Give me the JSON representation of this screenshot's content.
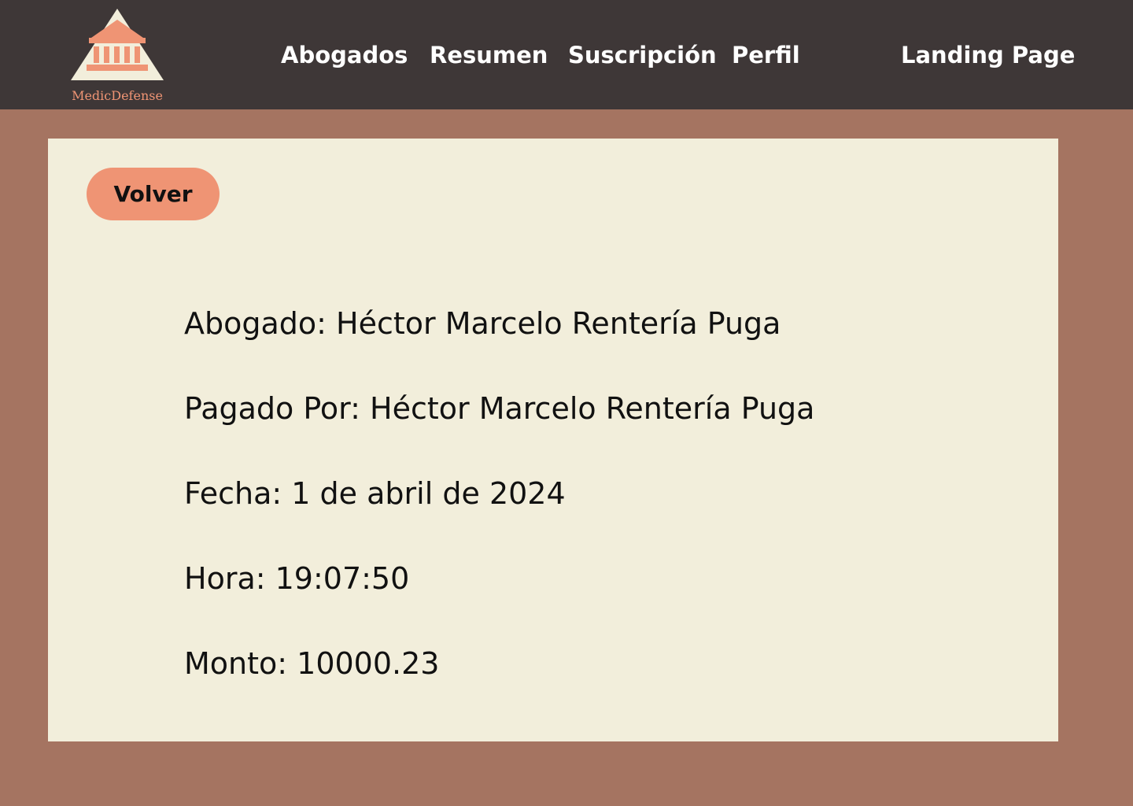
{
  "brand": {
    "name": "MedicDefense",
    "logo_icon": "bank-building-icon",
    "colors": {
      "accent": "#ef9474",
      "header_bg": "#3e3737",
      "page_bg": "#a57461",
      "card_bg": "#f2eedb"
    }
  },
  "nav": {
    "items": [
      {
        "label": "Abogados"
      },
      {
        "label": "Resumen"
      },
      {
        "label": "Suscripción"
      },
      {
        "label": "Perfil"
      }
    ],
    "landing_label": "Landing Page"
  },
  "main": {
    "back_label": "Volver",
    "details": [
      {
        "text": "Abogado: Héctor Marcelo Rentería Puga"
      },
      {
        "text": "Pagado Por: Héctor Marcelo Rentería Puga"
      },
      {
        "text": "Fecha: 1 de abril de 2024"
      },
      {
        "text": "Hora: 19:07:50"
      },
      {
        "text": "Monto: 10000.23"
      }
    ]
  }
}
